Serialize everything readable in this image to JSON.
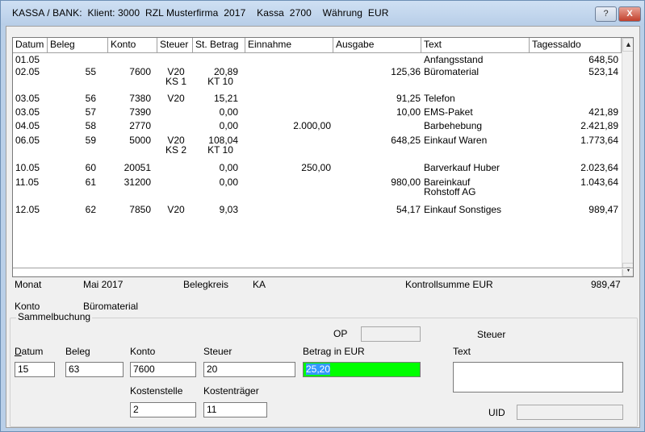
{
  "window": {
    "title": "KASSA / BANK:  Klient: 3000  RZL Musterfirma  2017    Kassa  2700    Währung  EUR",
    "help_label": "?",
    "close_label": "X"
  },
  "table": {
    "columns": [
      "Datum",
      "Beleg",
      "Konto",
      "Steuer",
      "St. Betrag",
      "Einnahme",
      "Ausgabe",
      "Text",
      "Tagessaldo"
    ],
    "rows": [
      {
        "datum": "01.05",
        "beleg": "",
        "konto": "",
        "steuer": "",
        "st_betrag": "",
        "einnahme": "",
        "ausgabe": "",
        "text": "Anfangsstand",
        "saldo": "648,50"
      },
      {
        "datum": "02.05",
        "beleg": "55",
        "konto": "7600",
        "steuer": "V20",
        "steuer2": "KS 1",
        "st_betrag": "20,89",
        "st_betrag2": "KT 10",
        "einnahme": "",
        "ausgabe": "125,36",
        "text": "Büromaterial",
        "saldo": "523,14"
      },
      {
        "datum": "03.05",
        "beleg": "56",
        "konto": "7380",
        "steuer": "V20",
        "st_betrag": "15,21",
        "einnahme": "",
        "ausgabe": "91,25",
        "text": "Telefon",
        "saldo": ""
      },
      {
        "datum": "03.05",
        "beleg": "57",
        "konto": "7390",
        "steuer": "",
        "st_betrag": "0,00",
        "einnahme": "",
        "ausgabe": "10,00",
        "text": "EMS-Paket",
        "saldo": "421,89"
      },
      {
        "datum": "04.05",
        "beleg": "58",
        "konto": "2770",
        "steuer": "",
        "st_betrag": "0,00",
        "einnahme": "2.000,00",
        "ausgabe": "",
        "text": "Barbehebung",
        "saldo": "2.421,89"
      },
      {
        "datum": "06.05",
        "beleg": "59",
        "konto": "5000",
        "steuer": "V20",
        "steuer2": "KS 2",
        "st_betrag": "108,04",
        "st_betrag2": "KT 10",
        "einnahme": "",
        "ausgabe": "648,25",
        "text": "Einkauf Waren",
        "saldo": "1.773,64"
      },
      {
        "datum": "10.05",
        "beleg": "60",
        "konto": "20051",
        "steuer": "",
        "st_betrag": "0,00",
        "einnahme": "250,00",
        "ausgabe": "",
        "text": "Barverkauf Huber",
        "saldo": "2.023,64"
      },
      {
        "datum": "11.05",
        "beleg": "61",
        "konto": "31200",
        "steuer": "",
        "st_betrag": "0,00",
        "einnahme": "",
        "ausgabe": "980,00",
        "text": "Bareinkauf",
        "text2": "Rohstoff AG",
        "saldo": "1.043,64"
      },
      {
        "datum": "12.05",
        "beleg": "62",
        "konto": "7850",
        "steuer": "V20",
        "st_betrag": "9,03",
        "einnahme": "",
        "ausgabe": "54,17",
        "text": "Einkauf Sonstiges",
        "saldo": "989,47"
      }
    ]
  },
  "summary": {
    "monat_label": "Monat",
    "monat_value": "Mai 2017",
    "belegkreis_label": "Belegkreis",
    "belegkreis_value": "KA",
    "kontrollsumme_label": "Kontrollsumme EUR",
    "kontrollsumme_value": "989,47",
    "konto_label": "Konto",
    "konto_value": "Büromaterial"
  },
  "form": {
    "group_label": "Sammelbuchung",
    "op_label": "OP",
    "steuer_top_label": "Steuer",
    "datum_label_first": "D",
    "datum_label_rest": "atum",
    "beleg_label": "Beleg",
    "konto_label": "Konto",
    "steuer_label": "Steuer",
    "betrag_label": "Betrag in EUR",
    "text_label": "Text",
    "kostenstelle_label": "Kostenstelle",
    "kostentraeger_label": "Kostenträger",
    "uid_label": "UID",
    "datum_value": "15",
    "beleg_value": "63",
    "konto_value": "7600",
    "steuer_value": "20",
    "betrag_value": "25,20",
    "kostenstelle_value": "2",
    "kostentraeger_value": "11",
    "betrag_highlight_color": "#00ff00"
  }
}
